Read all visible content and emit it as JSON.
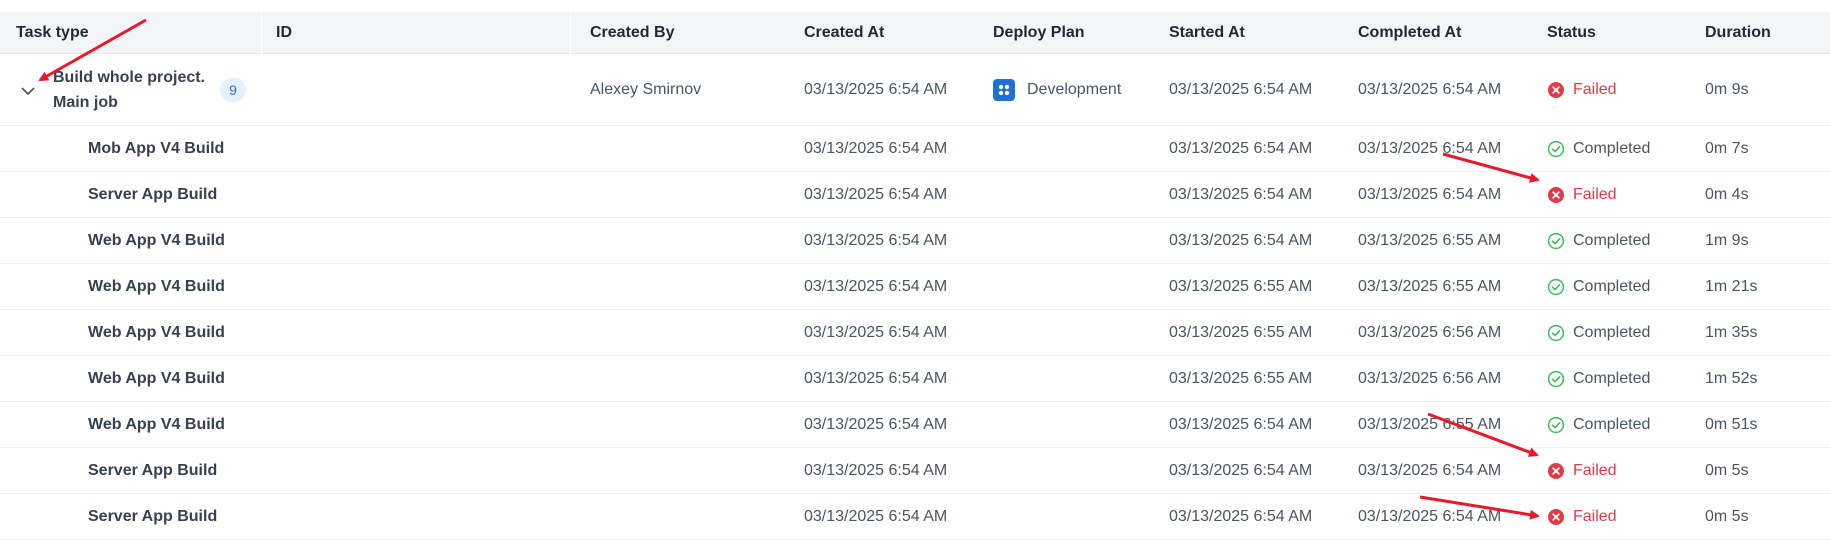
{
  "columns": {
    "task_type": "Task type",
    "id": "ID",
    "created_by": "Created By",
    "created_at": "Created At",
    "deploy_plan": "Deploy Plan",
    "started_at": "Started At",
    "completed_at": "Completed At",
    "status": "Status",
    "duration": "Duration"
  },
  "main_row": {
    "task_line1": "Build whole project.",
    "task_line2": "Main job",
    "count": "9",
    "created_by": "Alexey Smirnov",
    "created_at": "03/13/2025 6:54 AM",
    "deploy_plan": "Development",
    "started_at": "03/13/2025 6:54 AM",
    "completed_at": "03/13/2025 6:54 AM",
    "status": "Failed",
    "duration": "0m 9s"
  },
  "rows": [
    {
      "task": "Mob App V4 Build",
      "created_at": "03/13/2025 6:54 AM",
      "started_at": "03/13/2025 6:54 AM",
      "completed_at": "03/13/2025 6:54 AM",
      "status": "Completed",
      "duration": "0m 7s"
    },
    {
      "task": "Server App Build",
      "created_at": "03/13/2025 6:54 AM",
      "started_at": "03/13/2025 6:54 AM",
      "completed_at": "03/13/2025 6:54 AM",
      "status": "Failed",
      "duration": "0m 4s"
    },
    {
      "task": "Web App V4 Build",
      "created_at": "03/13/2025 6:54 AM",
      "started_at": "03/13/2025 6:54 AM",
      "completed_at": "03/13/2025 6:55 AM",
      "status": "Completed",
      "duration": "1m 9s"
    },
    {
      "task": "Web App V4 Build",
      "created_at": "03/13/2025 6:54 AM",
      "started_at": "03/13/2025 6:55 AM",
      "completed_at": "03/13/2025 6:55 AM",
      "status": "Completed",
      "duration": "1m 21s"
    },
    {
      "task": "Web App V4 Build",
      "created_at": "03/13/2025 6:54 AM",
      "started_at": "03/13/2025 6:55 AM",
      "completed_at": "03/13/2025 6:56 AM",
      "status": "Completed",
      "duration": "1m 35s"
    },
    {
      "task": "Web App V4 Build",
      "created_at": "03/13/2025 6:54 AM",
      "started_at": "03/13/2025 6:55 AM",
      "completed_at": "03/13/2025 6:56 AM",
      "status": "Completed",
      "duration": "1m 52s"
    },
    {
      "task": "Web App V4 Build",
      "created_at": "03/13/2025 6:54 AM",
      "started_at": "03/13/2025 6:54 AM",
      "completed_at": "03/13/2025 6:55 AM",
      "status": "Completed",
      "duration": "0m 51s"
    },
    {
      "task": "Server App Build",
      "created_at": "03/13/2025 6:54 AM",
      "started_at": "03/13/2025 6:54 AM",
      "completed_at": "03/13/2025 6:54 AM",
      "status": "Failed",
      "duration": "0m 5s"
    },
    {
      "task": "Server App Build",
      "created_at": "03/13/2025 6:54 AM",
      "started_at": "03/13/2025 6:54 AM",
      "completed_at": "03/13/2025 6:54 AM",
      "status": "Failed",
      "duration": "0m 5s"
    }
  ],
  "colors": {
    "failed": "#e23a46",
    "completed": "#3dbb5b",
    "badge_bg": "#e6f0ff",
    "plan_icon": "#1f6fd6",
    "annotation_arrow": "#e8192c"
  },
  "icons": {
    "expand": "chevron-down-icon",
    "failed": "x-circle-icon",
    "completed": "check-circle-icon",
    "deploy_plan": "apps-grid-icon"
  }
}
